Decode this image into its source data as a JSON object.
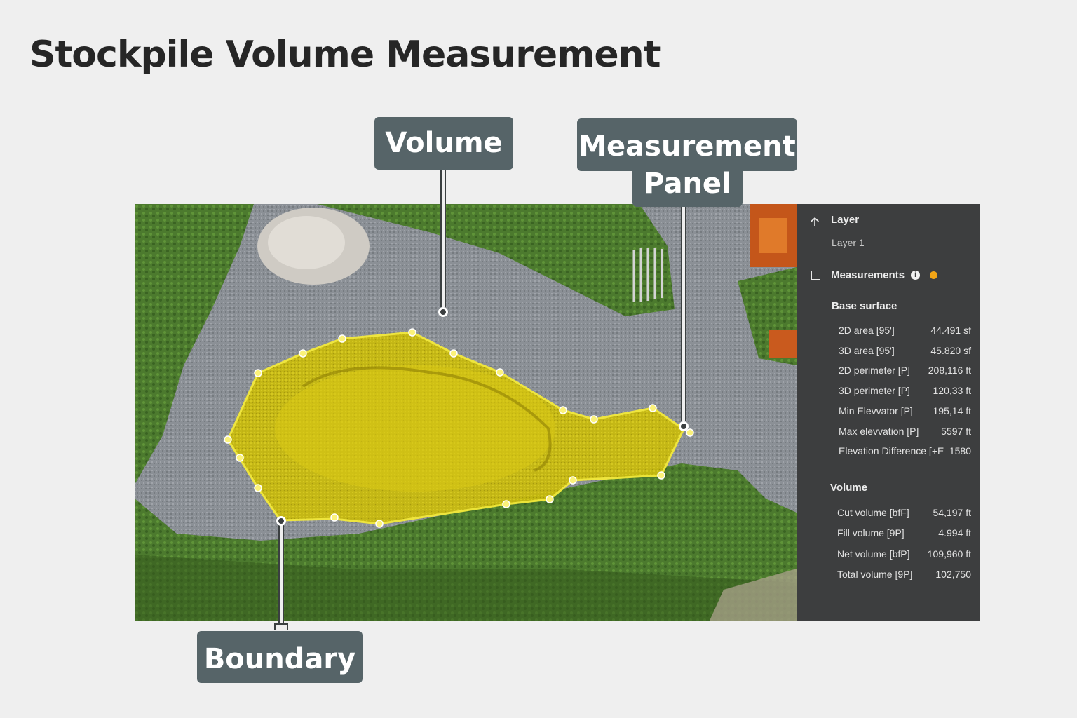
{
  "title": "Stockpile Volume Measurement",
  "callouts": {
    "volume": "Volume",
    "measurement_panel_line1": "Measurement",
    "measurement_panel_line2": "Panel",
    "boundary": "Boundary"
  },
  "panel": {
    "layer_header": "Layer",
    "layer_name": "Layer 1",
    "measurements_label": "Measurements",
    "measurements_checked": false,
    "status_color": "#f2a516",
    "base_surface_header": "Base surface",
    "base_surface_rows": [
      {
        "label": "2D area [95']",
        "value": "44.491 sf"
      },
      {
        "label": "3D area [95']",
        "value": "45.820 sf"
      },
      {
        "label": "2D perimeter [P]",
        "value": "208,116 ft"
      },
      {
        "label": "3D perimeter [P]",
        "value": "120,33 ft"
      },
      {
        "label": "Min Elevvator [P]",
        "value": "195,14 ft"
      },
      {
        "label": "Max elevvation [P]",
        "value": "5597 ft"
      },
      {
        "label": "Elevation Difference [+E",
        "value": "1580"
      }
    ],
    "volume_header": "Volume",
    "volume_rows": [
      {
        "label": "Cut volume [bfF]",
        "value": "54,197 ft"
      },
      {
        "label": "Fill volume [9P]",
        "value": "4.994 ft"
      },
      {
        "label": "Net volume [bfP]",
        "value": "109,960 ft"
      },
      {
        "label": "Total volume [9P]",
        "value": "102,750"
      }
    ]
  },
  "colors": {
    "boundary_fill": "#d9cc12",
    "boundary_stroke": "#f4ea3a",
    "callout_bg": "#566468",
    "panel_bg": "#3d3e3f"
  }
}
